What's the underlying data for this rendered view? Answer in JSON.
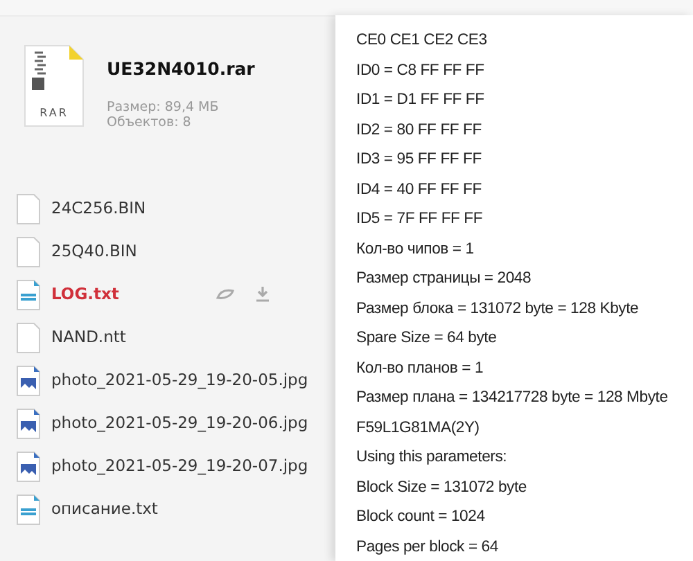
{
  "archive": {
    "name": "UE32N4010.rar",
    "type_label": "RAR",
    "size": "Размер: 89,4 МБ",
    "objects": "Объектов: 8"
  },
  "files": [
    {
      "name": "24C256.BIN",
      "kind": "blank",
      "selected": false
    },
    {
      "name": "25Q40.BIN",
      "kind": "blank",
      "selected": false
    },
    {
      "name": "LOG.txt",
      "kind": "text",
      "selected": true
    },
    {
      "name": "NAND.ntt",
      "kind": "blank",
      "selected": false
    },
    {
      "name": "photo_2021-05-29_19-20-05.jpg",
      "kind": "image",
      "selected": false
    },
    {
      "name": "photo_2021-05-29_19-20-06.jpg",
      "kind": "image",
      "selected": false
    },
    {
      "name": "photo_2021-05-29_19-20-07.jpg",
      "kind": "image",
      "selected": false
    },
    {
      "name": "описание.txt",
      "kind": "text",
      "selected": false
    }
  ],
  "preview": {
    "lines": [
      "CE0 CE1 CE2 CE3",
      "ID0 = C8 FF FF FF",
      "ID1 = D1 FF FF FF",
      "ID2 = 80 FF FF FF",
      "ID3 = 95 FF FF FF",
      "ID4 = 40 FF FF FF",
      "ID5 = 7F FF FF FF",
      "Кол-во чипов = 1",
      "Размер страницы = 2048",
      "Размер блока = 131072 byte = 128 Kbyte",
      "Spare Size = 64 byte",
      "Кол-во планов = 1",
      "Размер плана = 134217728 byte = 128 Mbyte",
      "F59L1G81MA(2Y)",
      "Using this parameters:",
      "Block Size = 131072 byte",
      "Block count = 1024",
      "Pages per block = 64"
    ]
  }
}
